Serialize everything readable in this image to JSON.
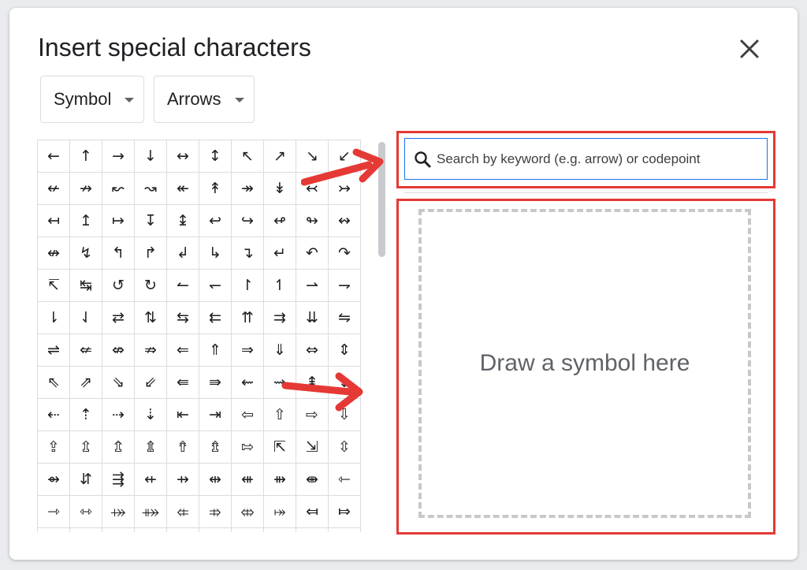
{
  "dialog": {
    "title": "Insert special characters"
  },
  "filters": {
    "category": "Symbol",
    "subcategory": "Arrows"
  },
  "search": {
    "placeholder": "Search by keyword (e.g. arrow) or codepoint"
  },
  "draw": {
    "label": "Draw a symbol here"
  },
  "symbols": [
    "←",
    "↑",
    "→",
    "↓",
    "↔",
    "↕",
    "↖",
    "↗",
    "↘",
    "↙",
    "↚",
    "↛",
    "↜",
    "↝",
    "↞",
    "↟",
    "↠",
    "↡",
    "↢",
    "↣",
    "↤",
    "↥",
    "↦",
    "↧",
    "↨",
    "↩",
    "↪",
    "↫",
    "↬",
    "↭",
    "↮",
    "↯",
    "↰",
    "↱",
    "↲",
    "↳",
    "↴",
    "↵",
    "↶",
    "↷",
    "↸",
    "↹",
    "↺",
    "↻",
    "↼",
    "↽",
    "↾",
    "↿",
    "⇀",
    "⇁",
    "⇂",
    "⇃",
    "⇄",
    "⇅",
    "⇆",
    "⇇",
    "⇈",
    "⇉",
    "⇊",
    "⇋",
    "⇌",
    "⇍",
    "⇎",
    "⇏",
    "⇐",
    "⇑",
    "⇒",
    "⇓",
    "⇔",
    "⇕",
    "⇖",
    "⇗",
    "⇘",
    "⇙",
    "⇚",
    "⇛",
    "⇜",
    "⇝",
    "⇞",
    "⇟",
    "⇠",
    "⇡",
    "⇢",
    "⇣",
    "⇤",
    "⇥",
    "⇦",
    "⇧",
    "⇨",
    "⇩",
    "⇪",
    "⇫",
    "⇬",
    "⇭",
    "⇮",
    "⇯",
    "⇰",
    "⇱",
    "⇲",
    "⇳",
    "⇴",
    "⇵",
    "⇶",
    "⇷",
    "⇸",
    "⇹",
    "⇺",
    "⇻",
    "⇼",
    "⇽",
    "⇾",
    "⇿",
    "⤀",
    "⤁",
    "⤂",
    "⤃",
    "⤄",
    "⤅",
    "⤆",
    "⤇",
    "⤈",
    "⤉",
    "⤊",
    "⤋",
    "⤌",
    "⤍",
    "⤎",
    "⤏",
    "⤐",
    "⤑"
  ],
  "colors": {
    "annotation": "#e53935",
    "accent": "#1a73e8",
    "text": "#202124",
    "border": "#dadce0"
  },
  "icons": {
    "close": "close-icon",
    "search": "search-icon",
    "caret": "caret-down-icon"
  }
}
